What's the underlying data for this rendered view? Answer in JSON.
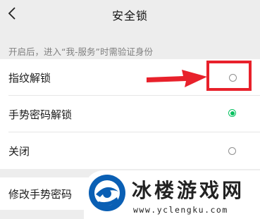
{
  "nav": {
    "title": "安全锁"
  },
  "hint": "开启后，进入“我-服务”时需验证身份",
  "options": [
    {
      "label": "指纹解锁",
      "checked": false
    },
    {
      "label": "手势密码解锁",
      "checked": true
    },
    {
      "label": "关闭",
      "checked": false
    }
  ],
  "change_gesture": {
    "label": "修改手势密码"
  },
  "watermark": {
    "title": "冰楼游戏网",
    "url": "www.yclengku.com"
  },
  "colors": {
    "accent": "#07c160",
    "annotation": "#e8212b",
    "background": "#ededed"
  }
}
